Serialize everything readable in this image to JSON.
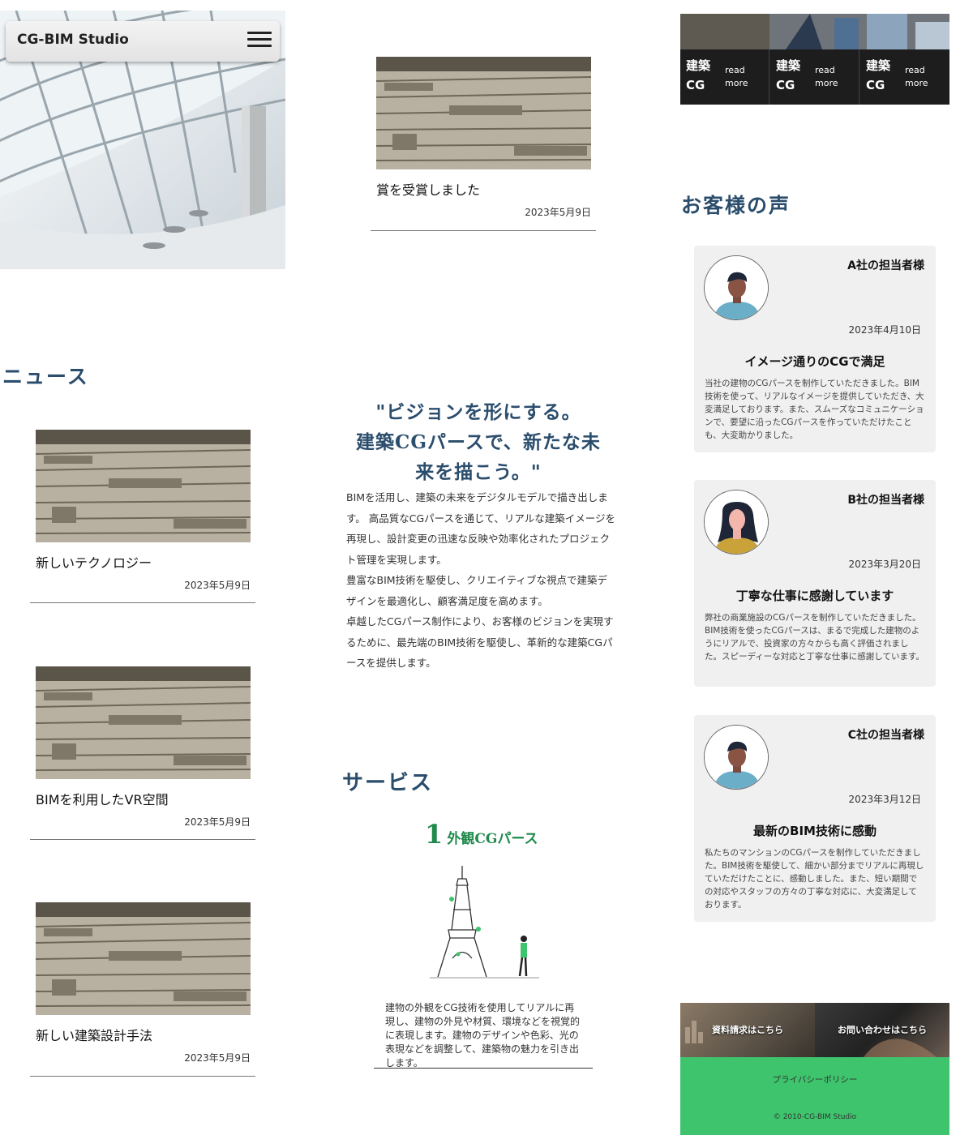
{
  "header": {
    "site_title": "CG-BIM Studio",
    "menu_icon": "hamburger-menu-icon"
  },
  "news": {
    "heading": "ニュース",
    "featured": {
      "title": "賞を受賞しました",
      "date": "2023年5月9日"
    },
    "items": [
      {
        "title": "新しいテクノロジー",
        "date": "2023年5月9日"
      },
      {
        "title": "BIMを利用したVR空間",
        "date": "2023年5月9日"
      },
      {
        "title": "新しい建築設計手法",
        "date": "2023年5月9日"
      }
    ]
  },
  "vision": {
    "heading_lines": [
      "\"ビジョンを形にする。",
      "建築CGパースで、新たな未",
      "来を描こう。\""
    ],
    "paragraphs": [
      "BIMを活用し、建築の未来をデジタルモデルで描き出します。 高品質なCGパースを通じて、リアルな建築イメージを再現し、設計変更の迅速な反映や効率化されたプロジェクト管理を実現します。",
      "豊富なBIM技術を駆使し、クリエイティブな視点で建築デザインを最適化し、顧客満足度を高めます。",
      "卓越したCGパース制作により、お客様のビジョンを実現するために、最先端のBIM技術を駆使し、革新的な建築CGパースを提供します。"
    ]
  },
  "services": {
    "heading": "サービス",
    "item": {
      "number": "1",
      "title": "外観CGパース",
      "description": "建物の外観をCG技術を使用してリアルに再現し、建物の外見や材質、環境などを視覚的に表現します。建物のデザインや色彩、光の表現などを調整して、建築物の魅力を引き出します。"
    }
  },
  "banner": {
    "items": [
      {
        "cg_line1": "建築",
        "cg_line2": "CG",
        "more_line1": "read",
        "more_line2": "more"
      },
      {
        "cg_line1": "建築",
        "cg_line2": "CG",
        "more_line1": "read",
        "more_line2": "more"
      },
      {
        "cg_line1": "建築",
        "cg_line2": "CG",
        "more_line1": "read",
        "more_line2": "more"
      }
    ]
  },
  "testimonials": {
    "heading": "お客様の声",
    "items": [
      {
        "company": "A社の担当者様",
        "date": "2023年4月10日",
        "title": "イメージ通りのCGで満足",
        "body": "当社の建物のCGパースを制作していただきました。BIM技術を使って、リアルなイメージを提供していただき、大変満足しております。また、スムーズなコミュニケーションで、要望に沿ったCGパースを作っていただけたことも、大変助かりました。"
      },
      {
        "company": "B社の担当者様",
        "date": "2023年3月20日",
        "title": "丁寧な仕事に感謝しています",
        "body": "弊社の商業施設のCGパースを制作していただきました。BIM技術を使ったCGパースは、まるで完成した建物のようにリアルで、投資家の方々からも高く評価されました。スピーディーな対応と丁寧な仕事に感謝しています。"
      },
      {
        "company": "C社の担当者様",
        "date": "2023年3月12日",
        "title": "最新のBIM技術に感動",
        "body": "私たちのマンションのCGパースを制作していただきました。BIM技術を駆使して、細かい部分までリアルに再現していただけたことに、感動しました。また、短い期間での対応やスタッフの方々の丁寧な対応に、大変満足しております。"
      }
    ]
  },
  "cta": {
    "documents": "資料請求はこちら",
    "contact": "お問い合わせはこちら"
  },
  "footer": {
    "privacy": "プライバシーポリシー",
    "copyright": "© 2010-CG-BIM Studio"
  },
  "colors": {
    "heading": "#2b4d6c",
    "accent_green": "#3ec46d",
    "service_green": "#1f8a4c"
  }
}
